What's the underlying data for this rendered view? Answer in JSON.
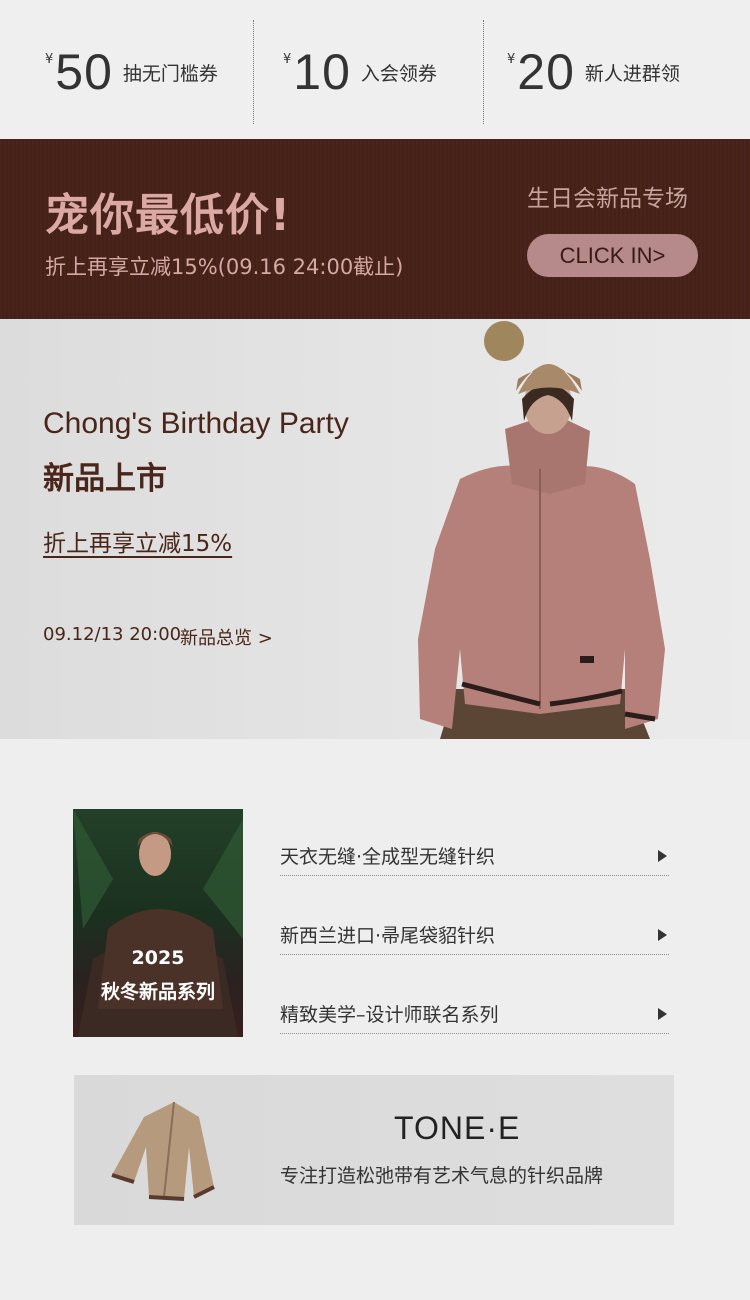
{
  "coupons": [
    {
      "currency": "¥",
      "amount": "50",
      "label": "抽无门槛券"
    },
    {
      "currency": "¥",
      "amount": "10",
      "label": "入会领券"
    },
    {
      "currency": "¥",
      "amount": "20",
      "label": "新人进群领"
    }
  ],
  "promo": {
    "title": "宠你最低价!",
    "subtitle": "折上再享立减15%(09.16 24:00截止)",
    "right_title": "生日会新品专场",
    "button": "CLICK IN>"
  },
  "hero": {
    "title_en": "Chong's Birthday Party",
    "title_cn": "新品上市",
    "discount": "折上再享立减15%",
    "date": "09.12/13 20:00",
    "link": "新品总览 >"
  },
  "series": {
    "thumb_year": "2025",
    "thumb_name": "秋冬新品系列",
    "items": [
      "天衣无缝·全成型无缝针织",
      "新西兰进口·帚尾袋貂针织",
      "精致美学–设计师联名系列"
    ]
  },
  "brand": {
    "name": "TONE·E",
    "desc": "专注打造松弛带有艺术气息的针织品牌"
  },
  "colors": {
    "banner_bg": "#4a2419",
    "accent_pink": "#dba8a3",
    "brown_text": "#4a2519",
    "button_bg": "#b6898a"
  }
}
